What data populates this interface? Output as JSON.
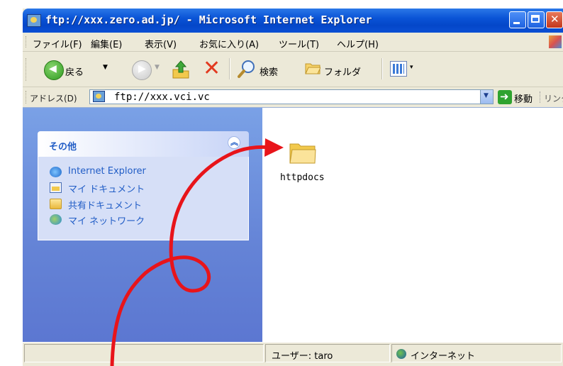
{
  "window": {
    "title": "ftp://xxx.zero.ad.jp/ - Microsoft Internet Explorer"
  },
  "menu": {
    "items": [
      "ファイル(F)",
      "編集(E)",
      "表示(V)",
      "お気に入り(A)",
      "ツール(T)",
      "ヘルプ(H)"
    ]
  },
  "toolbar": {
    "back_label": "戻る",
    "search_label": "検索",
    "folders_label": "フォルダ"
  },
  "address": {
    "label": "アドレス(D)",
    "value": "ftp://xxx.vci.vc",
    "go_label": "移動",
    "links_label": "リンク"
  },
  "taskpane": {
    "group_title": "その他",
    "items": [
      {
        "label": "Internet Explorer",
        "icon": "internet-explorer-icon"
      },
      {
        "label": "マイ ドキュメント",
        "icon": "my-documents-icon"
      },
      {
        "label": "共有ドキュメント",
        "icon": "shared-documents-icon"
      },
      {
        "label": "マイ ネットワーク",
        "icon": "my-network-icon"
      }
    ]
  },
  "files": [
    {
      "name": "httpdocs",
      "icon": "folder-icon"
    }
  ],
  "status": {
    "user": "ユーザー: taro",
    "zone": "インターネット"
  },
  "annotation": {
    "color": "#e8141a"
  }
}
